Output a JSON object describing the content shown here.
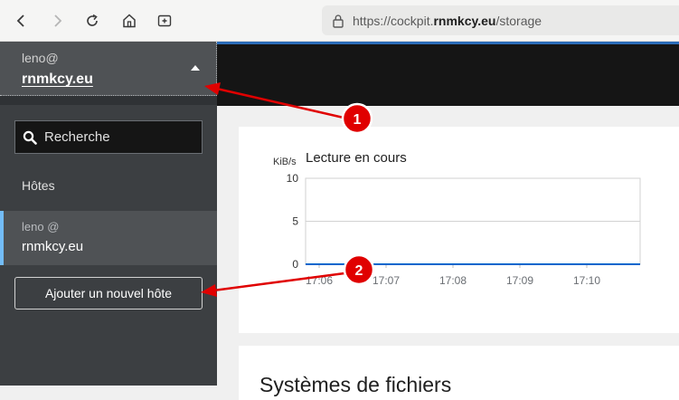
{
  "browser": {
    "url_prefix": "https://cockpit.",
    "url_domain": "rnmkcy.eu",
    "url_path": "/storage"
  },
  "sidebar": {
    "host_switcher": {
      "user": "leno@",
      "host": "rnmkcy.eu"
    },
    "search": {
      "placeholder": "Recherche"
    },
    "hosts_label": "Hôtes",
    "host_item": {
      "user": "leno @",
      "host": "rnmkcy.eu"
    },
    "add_host_label": "Ajouter un nouvel hôte"
  },
  "main": {
    "card2_title": "Systèmes de fichiers"
  },
  "annotations": [
    "1",
    "2"
  ],
  "colors": {
    "accent": "#2b6cb8",
    "annotation_red": "#e00000",
    "active_indicator": "#73bcf7"
  },
  "chart_data": {
    "type": "line",
    "title": "Lecture en cours",
    "ylabel": "KiB/s",
    "ylim": [
      0,
      10
    ],
    "yticks": [
      "10",
      "5",
      "0"
    ],
    "xticks": [
      "17:06",
      "17:07",
      "17:08",
      "17:09",
      "17:10"
    ],
    "series": [
      {
        "x": [
          "17:06",
          "17:07",
          "17:08",
          "17:09",
          "17:10"
        ],
        "values": [
          0,
          0,
          0,
          0,
          0
        ]
      }
    ]
  }
}
